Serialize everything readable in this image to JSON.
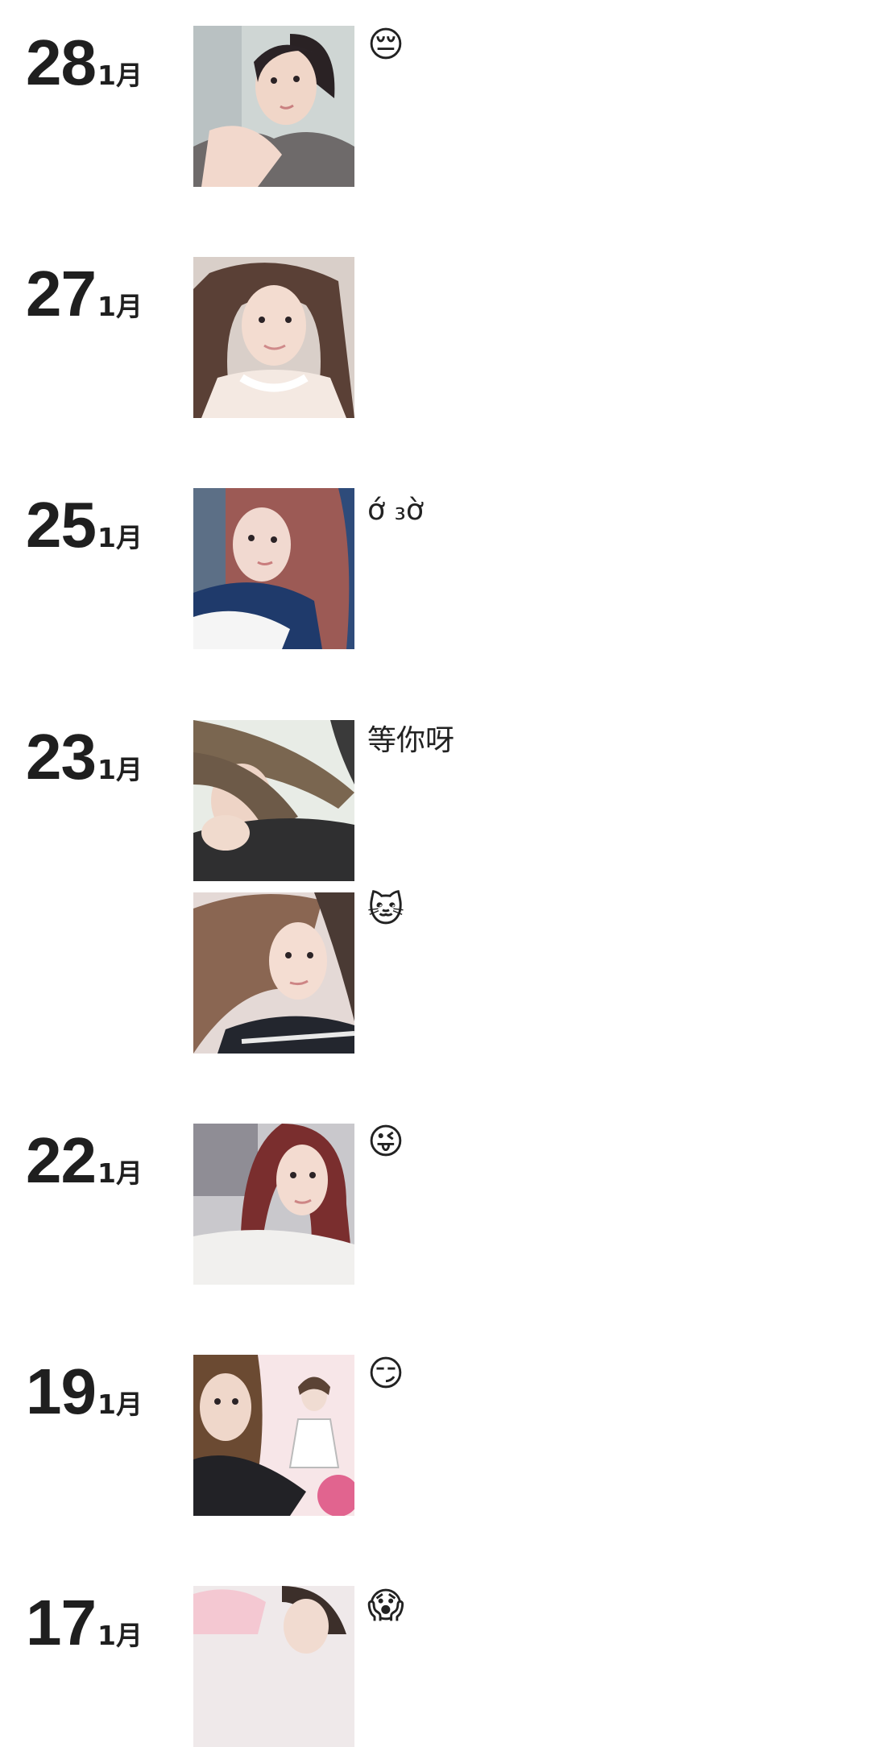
{
  "entries": [
    {
      "day": "28",
      "month": "1月",
      "posts": [
        {
          "caption": "😔",
          "emoji": true,
          "photo": "selfie-grey-sweater"
        }
      ]
    },
    {
      "day": "27",
      "month": "1月",
      "posts": [
        {
          "caption": "",
          "emoji": false,
          "photo": "selfie-lying-white-top"
        }
      ]
    },
    {
      "day": "25",
      "month": "1月",
      "posts": [
        {
          "caption": "ớ ₃ờ",
          "emoji": false,
          "photo": "selfie-red-hair-blue-sweater"
        }
      ]
    },
    {
      "day": "23",
      "month": "1月",
      "posts": [
        {
          "caption": "等你呀",
          "emoji": false,
          "photo": "selfie-hair-over-face"
        },
        {
          "caption": "🐱",
          "emoji": true,
          "photo": "selfie-hair-blowing"
        }
      ]
    },
    {
      "day": "22",
      "month": "1月",
      "posts": [
        {
          "caption": "😜",
          "emoji": true,
          "photo": "selfie-red-hair-white-coat"
        }
      ]
    },
    {
      "day": "19",
      "month": "1月",
      "posts": [
        {
          "caption": "😏",
          "emoji": true,
          "photo": "selfie-two-photos"
        }
      ]
    },
    {
      "day": "17",
      "month": "1月",
      "posts": [
        {
          "caption": "😱",
          "emoji": true,
          "photo": "selfie-pink-cap"
        }
      ]
    }
  ]
}
